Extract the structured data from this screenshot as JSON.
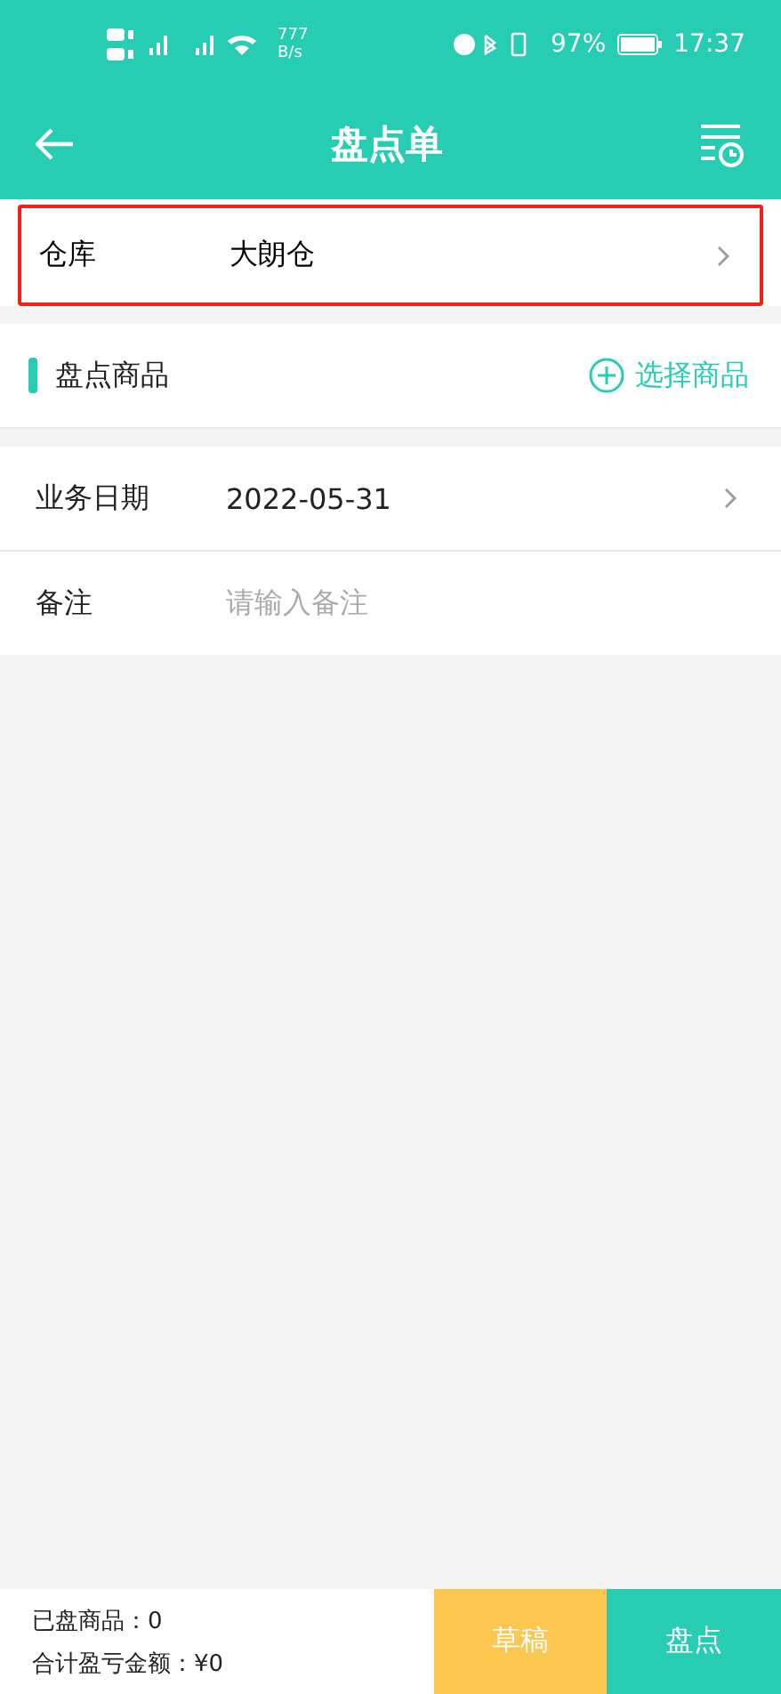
{
  "status_bar": {
    "net_speed": "777",
    "net_unit": "B/s",
    "battery": "97%",
    "time": "17:37"
  },
  "header": {
    "title": "盘点单"
  },
  "warehouse": {
    "label": "仓库",
    "value": "大朗仓",
    "highlighted": true
  },
  "products": {
    "title": "盘点商品",
    "action": "选择商品"
  },
  "fields": [
    {
      "kind": "select",
      "label": "业务日期",
      "value": "2022-05-31"
    },
    {
      "kind": "input",
      "label": "备注",
      "placeholder": "请输入备注"
    }
  ],
  "footer": {
    "counted": "已盘商品：0",
    "total": "合计盈亏金额：¥0",
    "buttons": [
      {
        "kind": "draft",
        "label": "草稿"
      },
      {
        "kind": "submit",
        "label": "盘点"
      }
    ]
  }
}
